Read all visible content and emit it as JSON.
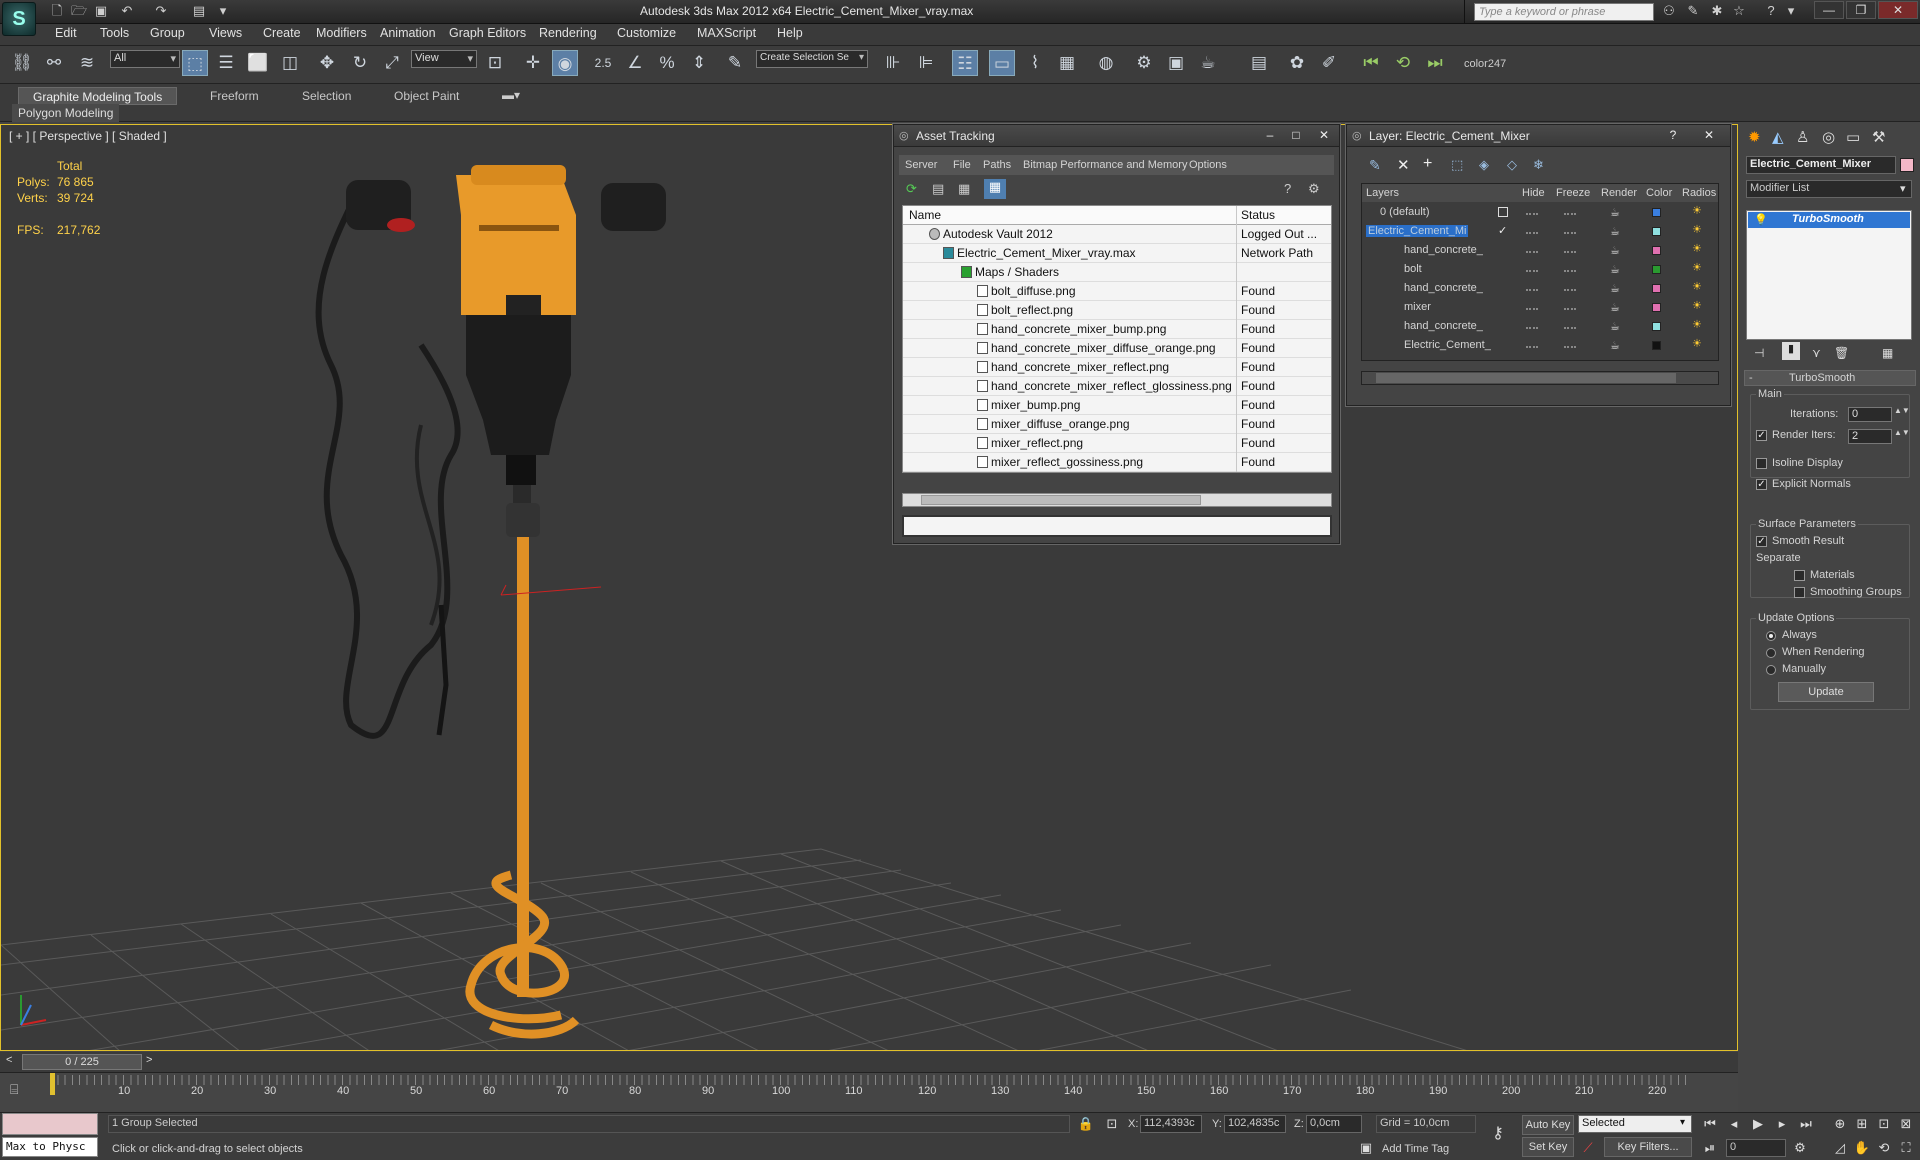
{
  "app": {
    "logo": "S",
    "title": "Autodesk 3ds Max  2012 x64      Electric_Cement_Mixer_vray.max",
    "search_placeholder": "Type a keyword or phrase"
  },
  "menu": [
    "Edit",
    "Tools",
    "Group",
    "Views",
    "Create",
    "Modifiers",
    "Animation",
    "Graph Editors",
    "Rendering",
    "Customize",
    "MAXScript",
    "Help"
  ],
  "toolbar": {
    "filter_select": "All",
    "ref_coord": "View",
    "snap_value": "2.5",
    "selection_set": "Create Selection Se",
    "color_label": "color247"
  },
  "ribbon": {
    "tabs": [
      "Graphite Modeling Tools",
      "Freeform",
      "Selection",
      "Object Paint"
    ],
    "panel_label": "Polygon Modeling"
  },
  "viewport": {
    "label": "[ + ] [ Perspective ] [ Shaded ]",
    "stats": {
      "total_label": "Total",
      "polys_label": "Polys:",
      "polys_value": "76 865",
      "verts_label": "Verts:",
      "verts_value": "39 724",
      "fps_label": "FPS:",
      "fps_value": "217,762"
    }
  },
  "asset_tracking": {
    "title": "Asset Tracking",
    "menu": [
      "Server",
      "File",
      "Paths",
      "Bitmap Performance and Memory",
      "Options"
    ],
    "columns": [
      "Name",
      "Status"
    ],
    "rows": [
      {
        "name": "Autodesk Vault 2012",
        "status": "Logged Out ..."
      },
      {
        "name": "Electric_Cement_Mixer_vray.max",
        "status": "Network Path"
      },
      {
        "name": "Maps / Shaders",
        "status": ""
      },
      {
        "name": "bolt_diffuse.png",
        "status": "Found"
      },
      {
        "name": "bolt_reflect.png",
        "status": "Found"
      },
      {
        "name": "hand_concrete_mixer_bump.png",
        "status": "Found"
      },
      {
        "name": "hand_concrete_mixer_diffuse_orange.png",
        "status": "Found"
      },
      {
        "name": "hand_concrete_mixer_reflect.png",
        "status": "Found"
      },
      {
        "name": "hand_concrete_mixer_reflect_glossiness.png",
        "status": "Found"
      },
      {
        "name": "mixer_bump.png",
        "status": "Found"
      },
      {
        "name": "mixer_diffuse_orange.png",
        "status": "Found"
      },
      {
        "name": "mixer_reflect.png",
        "status": "Found"
      },
      {
        "name": "mixer_reflect_gossiness.png",
        "status": "Found"
      }
    ]
  },
  "layer_manager": {
    "title": "Layer: Electric_Cement_Mixer",
    "columns": [
      "Layers",
      "Hide",
      "Freeze",
      "Render",
      "Color",
      "Radios"
    ],
    "rows": [
      {
        "name": "0 (default)",
        "color": "#3a7fe0"
      },
      {
        "name": "Electric_Cement_Mi",
        "color": "#8fe0e0"
      },
      {
        "name": "hand_concrete_",
        "color": "#e070b0"
      },
      {
        "name": "bolt",
        "color": "#2a9a30"
      },
      {
        "name": "hand_concrete_",
        "color": "#e070b0"
      },
      {
        "name": "mixer",
        "color": "#e070b0"
      },
      {
        "name": "hand_concrete_",
        "color": "#8fe0e0"
      },
      {
        "name": "Electric_Cement_",
        "color": "#111111"
      }
    ]
  },
  "command_panel": {
    "object_name": "Electric_Cement_Mixer",
    "modifier_list": "Modifier List",
    "stack_item": "TurboSmooth",
    "rollout_title": "TurboSmooth",
    "main_label": "Main",
    "iterations_label": "Iterations:",
    "iterations_value": "0",
    "render_iters_label": "Render Iters:",
    "render_iters_value": "2",
    "isoline_label": "Isoline Display",
    "explicit_normals_label": "Explicit Normals",
    "surface_params_label": "Surface Parameters",
    "smooth_result_label": "Smooth Result",
    "separate_label": "Separate",
    "materials_label": "Materials",
    "smoothing_groups_label": "Smoothing Groups",
    "update_options_label": "Update Options",
    "always_label": "Always",
    "when_rendering_label": "When Rendering",
    "manually_label": "Manually",
    "update_button": "Update"
  },
  "timeline": {
    "frame_counter": "0 / 225",
    "ticks": [
      "10",
      "20",
      "30",
      "40",
      "50",
      "60",
      "70",
      "80",
      "90",
      "100",
      "110",
      "120",
      "130",
      "140",
      "150",
      "160",
      "170",
      "180",
      "190",
      "200",
      "210",
      "220"
    ]
  },
  "status": {
    "listener": "Max to Physc",
    "selection": "1 Group Selected",
    "prompt": "Click or click-and-drag to select objects",
    "x_label": "X:",
    "x_value": "112,4393c",
    "y_label": "Y:",
    "y_value": "102,4835c",
    "z_label": "Z:",
    "z_value": "0,0cm",
    "grid": "Grid = 10,0cm",
    "add_time_tag": "Add Time Tag",
    "auto_key": "Auto Key",
    "set_key": "Set Key",
    "key_mode": "Selected",
    "key_filters": "Key Filters...",
    "frame": "0"
  }
}
